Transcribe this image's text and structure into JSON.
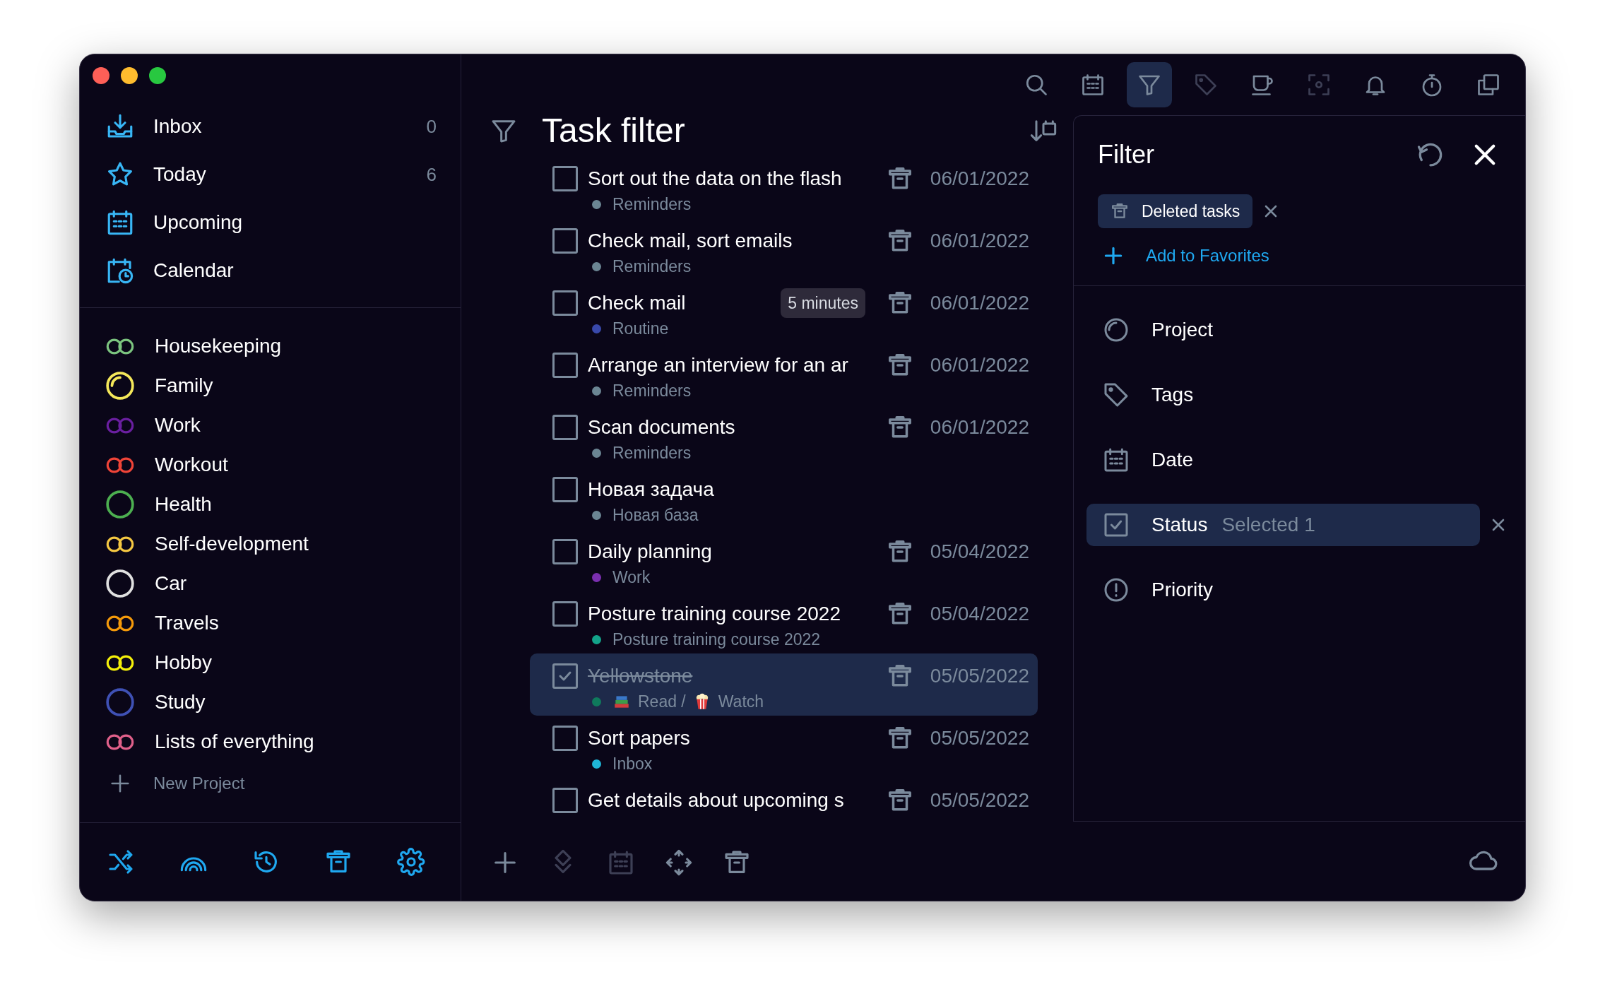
{
  "sidebar": {
    "smart_lists": [
      {
        "kind": "inbox",
        "label": "Inbox",
        "count": "0"
      },
      {
        "kind": "today",
        "label": "Today",
        "count": "6"
      },
      {
        "kind": "upcoming",
        "label": "Upcoming"
      },
      {
        "kind": "calendar",
        "label": "Calendar"
      }
    ],
    "projects": [
      {
        "label": "Housekeeping",
        "color": "#7cc47f",
        "kind": "double"
      },
      {
        "label": "Family",
        "color": "#f5e85a",
        "kind": "partial"
      },
      {
        "label": "Work",
        "color": "#6a1fa0",
        "kind": "double"
      },
      {
        "label": "Workout",
        "color": "#f04438",
        "kind": "double"
      },
      {
        "label": "Health",
        "color": "#4caf50",
        "kind": "circle"
      },
      {
        "label": "Self-development",
        "color": "#f5c842",
        "kind": "double"
      },
      {
        "label": "Car",
        "color": "#e0e0e0",
        "kind": "circle"
      },
      {
        "label": "Travels",
        "color": "#f59a0a",
        "kind": "double"
      },
      {
        "label": "Hobby",
        "color": "#f5f00a",
        "kind": "double"
      },
      {
        "label": "Study",
        "color": "#3f51b5",
        "kind": "circle"
      },
      {
        "label": "Lists of everything",
        "color": "#e0608a",
        "kind": "double"
      }
    ],
    "new_project": "New Project",
    "footer": [
      {
        "kind": "shuffle"
      },
      {
        "kind": "rainbow"
      },
      {
        "kind": "history"
      },
      {
        "kind": "trash"
      },
      {
        "kind": "gear"
      }
    ]
  },
  "toolbar": [
    {
      "kind": "search",
      "selected": false,
      "disabled": false
    },
    {
      "kind": "calendar",
      "selected": false,
      "disabled": false
    },
    {
      "kind": "filter",
      "selected": true,
      "disabled": false
    },
    {
      "kind": "tag",
      "selected": false,
      "disabled": true
    },
    {
      "kind": "cup",
      "selected": false,
      "disabled": false
    },
    {
      "kind": "focus",
      "selected": false,
      "disabled": true
    },
    {
      "kind": "bell",
      "selected": false,
      "disabled": false
    },
    {
      "kind": "stopwatch",
      "selected": false,
      "disabled": false
    },
    {
      "kind": "copy",
      "selected": false,
      "disabled": false
    }
  ],
  "main": {
    "title": "Task filter",
    "tasks": [
      {
        "title": "Sort out the data on the flash",
        "project": "Reminders",
        "color": "#6b8593",
        "date": "06/01/2022",
        "deleted": true,
        "checked": false,
        "selected": false
      },
      {
        "title": "Check mail, sort emails",
        "project": "Reminders",
        "color": "#6b8593",
        "date": "06/01/2022",
        "deleted": true,
        "checked": false,
        "selected": false
      },
      {
        "title": "Check mail",
        "duration": "5 minutes",
        "project": "Routine",
        "color": "#3949ab",
        "date": "06/01/2022",
        "deleted": true,
        "checked": false,
        "selected": false
      },
      {
        "title": "Arrange an interview for an ar",
        "project": "Reminders",
        "color": "#6b8593",
        "date": "06/01/2022",
        "deleted": true,
        "checked": false,
        "selected": false
      },
      {
        "title": "Scan documents",
        "project": "Reminders",
        "color": "#6b8593",
        "date": "06/01/2022",
        "deleted": true,
        "checked": false,
        "selected": false
      },
      {
        "title": "Новая задача",
        "project": "Новая база",
        "color": "#6b8593",
        "deleted": false,
        "checked": false,
        "selected": false
      },
      {
        "title": "Daily planning",
        "project": "Work",
        "color": "#7b2fb0",
        "date": "05/04/2022",
        "deleted": true,
        "checked": false,
        "selected": false
      },
      {
        "title": "Posture training course 2022",
        "project": "Posture training course 2022",
        "color": "#13a38a",
        "date": "05/04/2022",
        "deleted": true,
        "checked": false,
        "selected": false
      },
      {
        "title": "Yellowstone",
        "project_parts": [
          {
            "kind": "books",
            "text": "Read /"
          },
          {
            "kind": "popcorn",
            "text": "Watch"
          }
        ],
        "color": "#0f7a5c",
        "date": "05/05/2022",
        "deleted": true,
        "checked": true,
        "selected": true
      },
      {
        "title": "Sort papers",
        "project": "Inbox",
        "color": "#1fb5d6",
        "date": "05/05/2022",
        "deleted": true,
        "checked": false,
        "selected": false
      },
      {
        "title": "Get details about upcoming s",
        "date": "05/05/2022",
        "deleted": true,
        "checked": false,
        "selected": false
      }
    ],
    "footer": [
      {
        "kind": "plus",
        "disabled": false
      },
      {
        "kind": "layers",
        "disabled": true
      },
      {
        "kind": "calendar",
        "disabled": true
      },
      {
        "kind": "move",
        "disabled": false
      },
      {
        "kind": "trash",
        "disabled": false
      }
    ]
  },
  "filter": {
    "title": "Filter",
    "chips": [
      {
        "label": "Deleted tasks"
      }
    ],
    "add_favorites": "Add to Favorites",
    "criteria": [
      {
        "kind": "project",
        "label": "Project",
        "selected": false
      },
      {
        "kind": "tags",
        "label": "Tags",
        "selected": false
      },
      {
        "kind": "date",
        "label": "Date",
        "selected": false
      },
      {
        "kind": "status",
        "label": "Status",
        "value": "Selected 1",
        "selected": true
      },
      {
        "kind": "priority",
        "label": "Priority",
        "selected": false
      }
    ]
  }
}
